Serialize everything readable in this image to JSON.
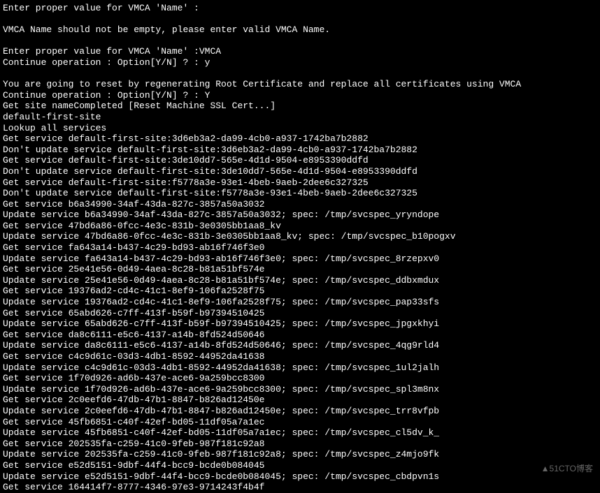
{
  "terminal": {
    "lines": [
      "Enter proper value for VMCA 'Name' :",
      "",
      "VMCA Name should not be empty, please enter valid VMCA Name.",
      "",
      "Enter proper value for VMCA 'Name' :VMCA",
      "Continue operation : Option[Y/N] ? : y",
      "",
      "You are going to reset by regenerating Root Certificate and replace all certificates using VMCA",
      "Continue operation : Option[Y/N] ? : Y",
      "Get site nameCompleted [Reset Machine SSL Cert...]",
      "default-first-site",
      "Lookup all services",
      "Get service default-first-site:3d6eb3a2-da99-4cb0-a937-1742ba7b2882",
      "Don't update service default-first-site:3d6eb3a2-da99-4cb0-a937-1742ba7b2882",
      "Get service default-first-site:3de10dd7-565e-4d1d-9504-e8953390ddfd",
      "Don't update service default-first-site:3de10dd7-565e-4d1d-9504-e8953390ddfd",
      "Get service default-first-site:f5778a3e-93e1-4beb-9aeb-2dee6c327325",
      "Don't update service default-first-site:f5778a3e-93e1-4beb-9aeb-2dee6c327325",
      "Get service b6a34990-34af-43da-827c-3857a50a3032",
      "Update service b6a34990-34af-43da-827c-3857a50a3032; spec: /tmp/svcspec_yryndope",
      "Get service 47bd6a86-0fcc-4e3c-831b-3e0305bb1aa8_kv",
      "Update service 47bd6a86-0fcc-4e3c-831b-3e0305bb1aa8_kv; spec: /tmp/svcspec_b10pogxv",
      "Get service fa643a14-b437-4c29-bd93-ab16f746f3e0",
      "Update service fa643a14-b437-4c29-bd93-ab16f746f3e0; spec: /tmp/svcspec_8rzepxv0",
      "Get service 25e41e56-0d49-4aea-8c28-b81a51bf574e",
      "Update service 25e41e56-0d49-4aea-8c28-b81a51bf574e; spec: /tmp/svcspec_ddbxmdux",
      "Get service 19376ad2-cd4c-41c1-8ef9-106fa2528f75",
      "Update service 19376ad2-cd4c-41c1-8ef9-106fa2528f75; spec: /tmp/svcspec_pap33sfs",
      "Get service 65abd626-c7ff-413f-b59f-b97394510425",
      "Update service 65abd626-c7ff-413f-b59f-b97394510425; spec: /tmp/svcspec_jpgxkhyi",
      "Get service da8c6111-e5c6-4137-a14b-8fd524d50646",
      "Update service da8c6111-e5c6-4137-a14b-8fd524d50646; spec: /tmp/svcspec_4qg9rld4",
      "Get service c4c9d61c-03d3-4db1-8592-44952da41638",
      "Update service c4c9d61c-03d3-4db1-8592-44952da41638; spec: /tmp/svcspec_1ul2jalh",
      "Get service 1f70d926-ad6b-437e-ace6-9a259bcc8300",
      "Update service 1f70d926-ad6b-437e-ace6-9a259bcc8300; spec: /tmp/svcspec_spl3m8nx",
      "Get service 2c0eefd6-47db-47b1-8847-b826ad12450e",
      "Update service 2c0eefd6-47db-47b1-8847-b826ad12450e; spec: /tmp/svcspec_trr8vfpb",
      "Get service 45fb6851-c40f-42ef-bd05-11df05a7a1ec",
      "Update service 45fb6851-c40f-42ef-bd05-11df05a7a1ec; spec: /tmp/svcspec_cl5dv_k_",
      "Get service 202535fa-c259-41c0-9feb-987f181c92a8",
      "Update service 202535fa-c259-41c0-9feb-987f181c92a8; spec: /tmp/svcspec_z4mjo9fk",
      "Get service e52d5151-9dbf-44f4-bcc9-bcde0b084045",
      "Update service e52d5151-9dbf-44f4-bcc9-bcde0b084045; spec: /tmp/svcspec_cbdpvn1s",
      "Get service 164414f7-8777-4346-97e3-9714243f4b4f"
    ]
  },
  "watermark": "▲51CTO博客"
}
